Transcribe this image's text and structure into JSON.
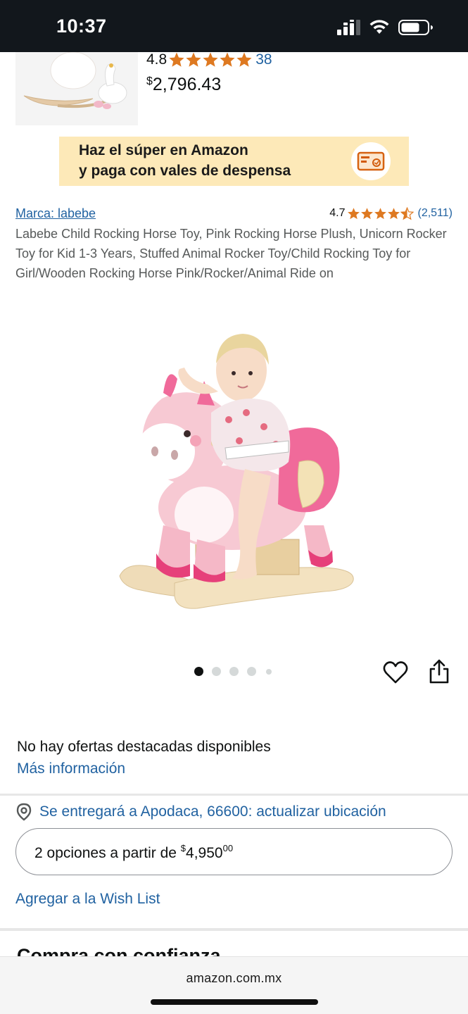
{
  "status_bar": {
    "time": "10:37",
    "icons": [
      "signal-icon",
      "wifi-icon",
      "battery-icon"
    ]
  },
  "previous_product": {
    "rating": "4.8",
    "stars": 5,
    "review_count": "38",
    "price_symbol": "$",
    "price": "2,796.43"
  },
  "promo_banner": {
    "line1": "Haz el súper en Amazon",
    "line2": "y paga con vales de despensa",
    "icon": "voucher-card-icon"
  },
  "product": {
    "brand": "Marca: labebe",
    "rating": "4.7",
    "stars": 4.5,
    "review_count": "(2,511)",
    "title": "Labebe Child Rocking Horse Toy, Pink Rocking Horse Plush, Unicorn Rocker Toy for Kid 1-3 Years, Stuffed Animal Rocker Toy/Child Rocking Toy for Girl/Wooden Rocking Horse Pink/Rocker/Animal Ride on",
    "image_dots": 5,
    "active_image_index": 0
  },
  "offers": {
    "no_offers_text": "No hay ofertas destacadas disponibles",
    "more_info": "Más información",
    "delivery_text": "Se entregará a Apodaca, 66600: actualizar ubicación",
    "options_prefix": "2 opciones a partir de ",
    "options_price_symbol": "$",
    "options_price_whole": "4,950",
    "options_price_cents": "00",
    "wishlist": "Agregar a la Wish List",
    "next_section_heading": "Compra con confianza"
  },
  "browser": {
    "url": "amazon.com.mx"
  },
  "colors": {
    "link": "#2162a1",
    "star": "#de7921",
    "banner": "#fde9b8",
    "status_bar": "#12171c"
  }
}
